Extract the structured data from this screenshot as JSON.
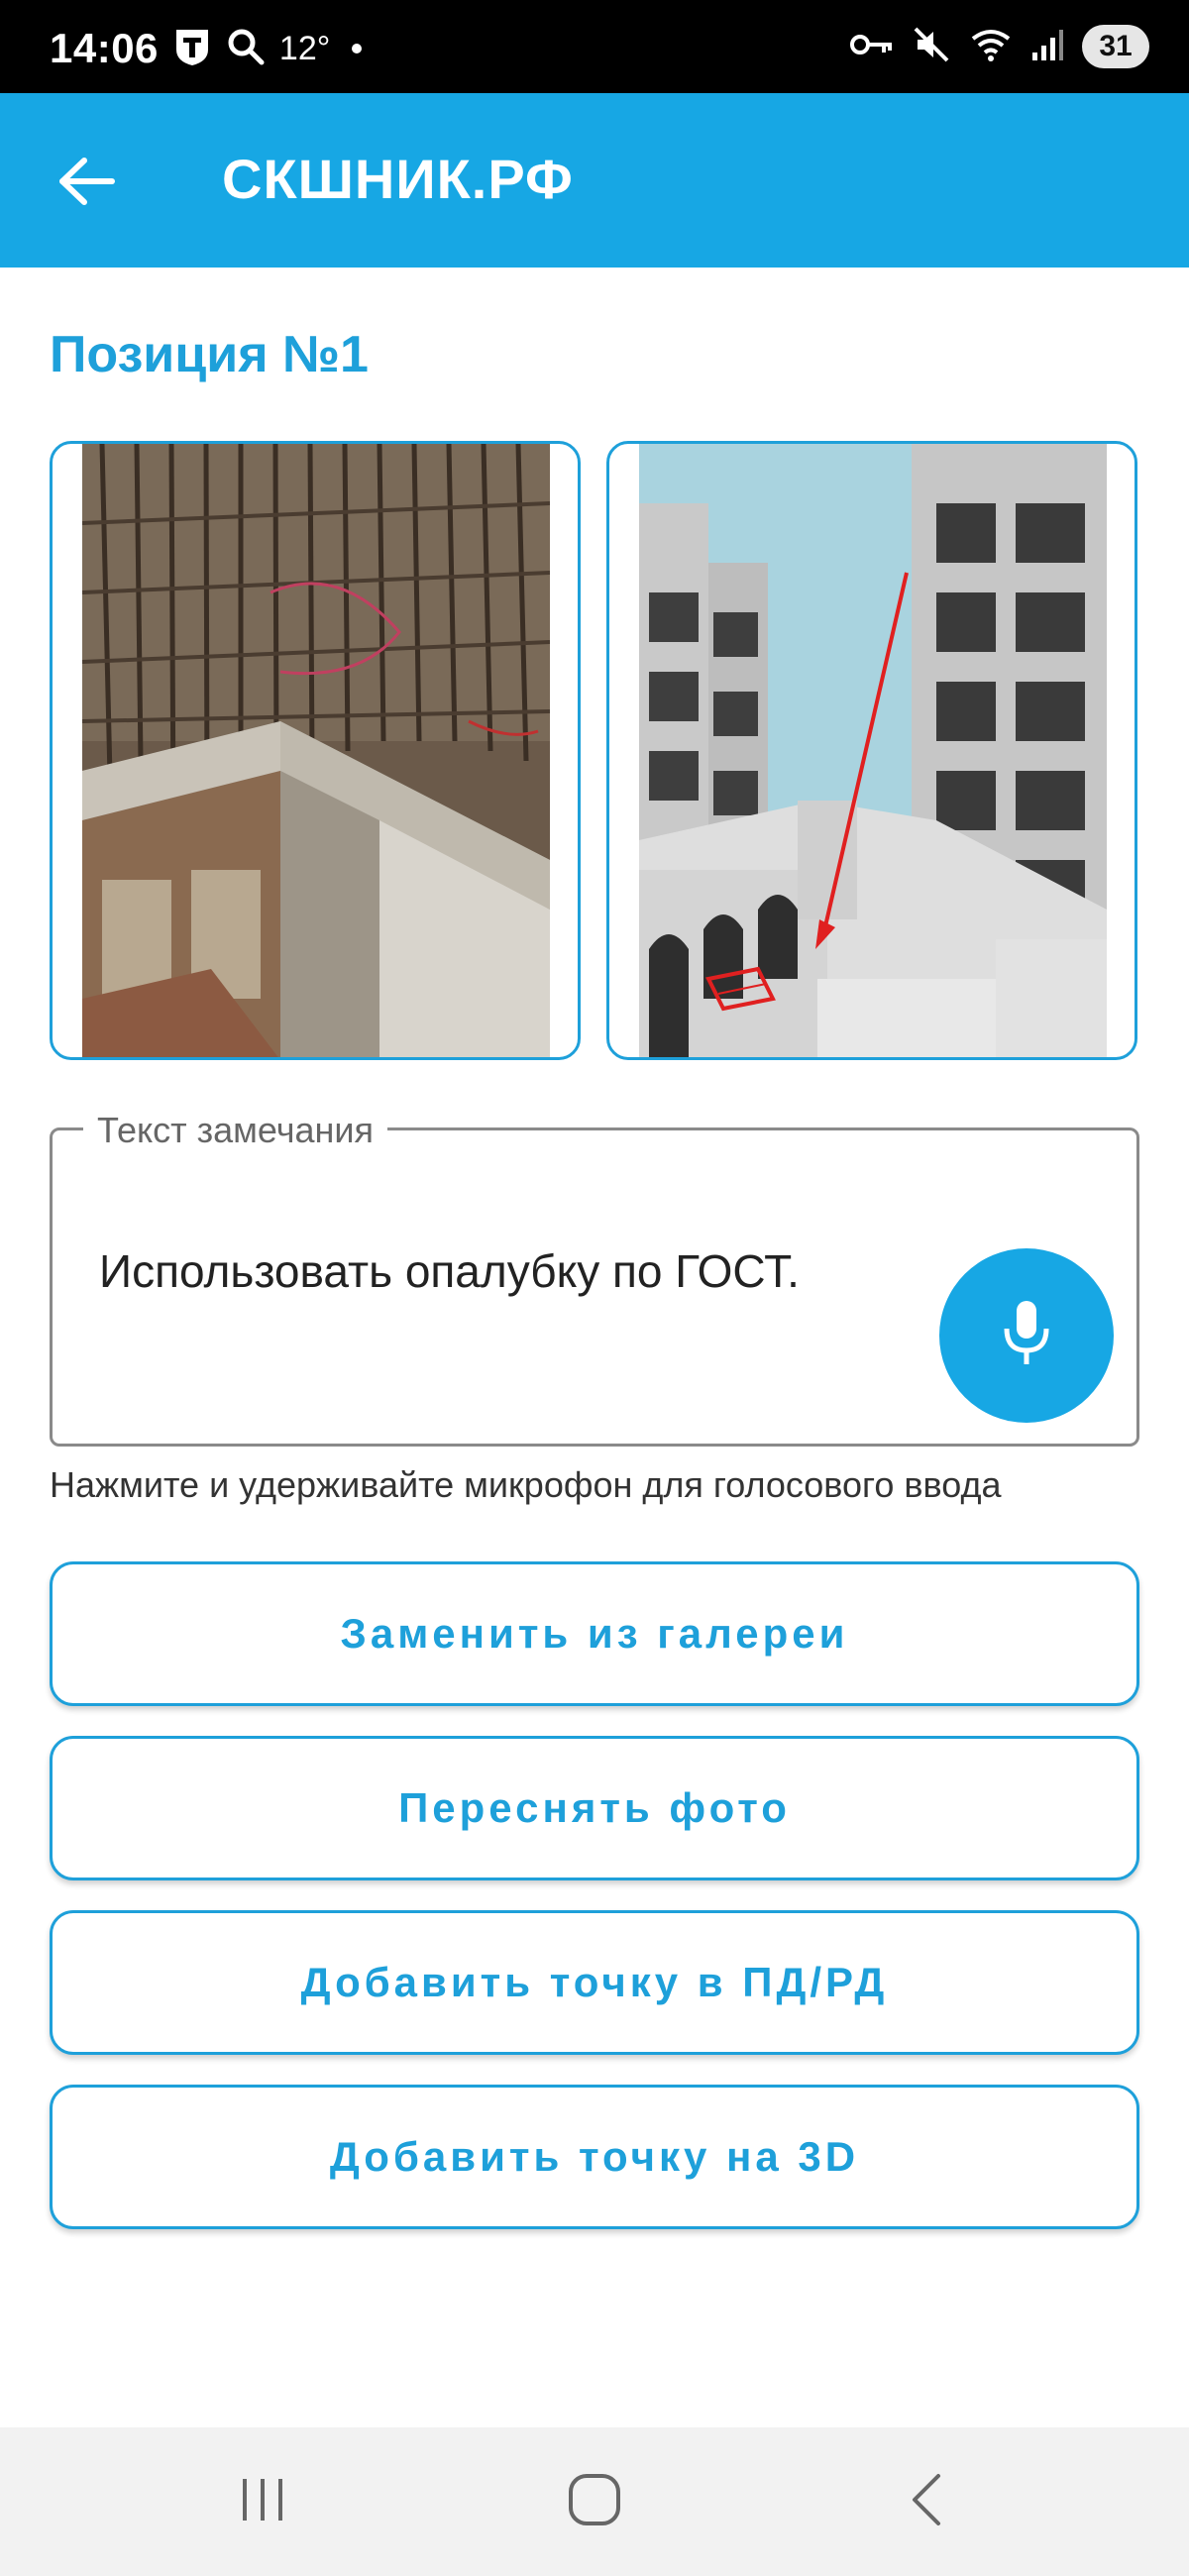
{
  "status_bar": {
    "time": "14:06",
    "temperature": "12°",
    "battery": "31",
    "icons": [
      "t-app-icon",
      "search-icon",
      "vpn-key-icon",
      "mute-icon",
      "wifi-icon",
      "signal-icon"
    ]
  },
  "app_bar": {
    "title": "СКШНИК.РФ",
    "back_icon": "arrow-left-icon",
    "color": "#17a7e4"
  },
  "main": {
    "position_title": "Позиция №1",
    "photos": [
      {
        "name": "rebar-photo"
      },
      {
        "name": "3d-model-photo"
      }
    ],
    "remark": {
      "label": "Текст замечания",
      "value": "Использовать опалубку по ГОСТ.",
      "mic_icon": "microphone-icon"
    },
    "hint": "Нажмите и удерживайте микрофон для голосового ввода",
    "buttons": [
      {
        "label": "Заменить из галереи"
      },
      {
        "label": "Переснять фото"
      },
      {
        "label": "Добавить точку в ПД/РД"
      },
      {
        "label": "Добавить точку на 3D"
      }
    ],
    "accent_color": "#1ea0da"
  },
  "nav_bar": {
    "icons": [
      "recent-apps-icon",
      "home-icon",
      "back-icon"
    ]
  }
}
